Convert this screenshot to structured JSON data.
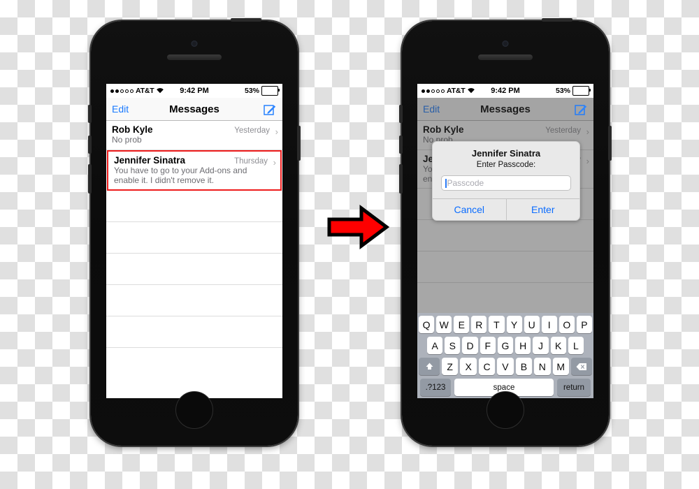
{
  "status_bar": {
    "signal_dots_filled": 2,
    "signal_dots_total": 5,
    "carrier": "AT&T",
    "wifi_icon": "wifi-icon",
    "time": "9:42 PM",
    "battery_percent": "53%",
    "battery_level": 53
  },
  "nav": {
    "edit_label": "Edit",
    "title": "Messages",
    "compose_icon": "compose-pencil-icon"
  },
  "messages": [
    {
      "name": "Rob Kyle",
      "time": "Yesterday",
      "preview": "No prob",
      "highlighted": false
    },
    {
      "name": "Jennifer Sinatra",
      "time": "Thursday",
      "preview": "You have to go to your Add-ons and enable it. I didn't remove it.",
      "highlighted": true
    }
  ],
  "empty_rows": 5,
  "highlight_color": "#ee1c1c",
  "accent_color": "#0a6cff",
  "arrow": {
    "icon": "right-arrow-icon",
    "fill": "#fe0000",
    "stroke": "#000000"
  },
  "dialog": {
    "title": "Jennifer Sinatra",
    "subtitle": "Enter Passcode:",
    "input_value": "",
    "input_placeholder": "Passcode",
    "cancel_label": "Cancel",
    "enter_label": "Enter"
  },
  "keyboard": {
    "row1": [
      "Q",
      "W",
      "E",
      "R",
      "T",
      "Y",
      "U",
      "I",
      "O",
      "P"
    ],
    "row2": [
      "A",
      "S",
      "D",
      "F",
      "G",
      "H",
      "J",
      "K",
      "L"
    ],
    "row3": [
      "Z",
      "X",
      "C",
      "V",
      "B",
      "N",
      "M"
    ],
    "shift_icon": "shift-up-arrow-icon",
    "delete_icon": "backspace-delete-icon",
    "numeric_label": ".?123",
    "space_label": "space",
    "return_label": "return"
  }
}
